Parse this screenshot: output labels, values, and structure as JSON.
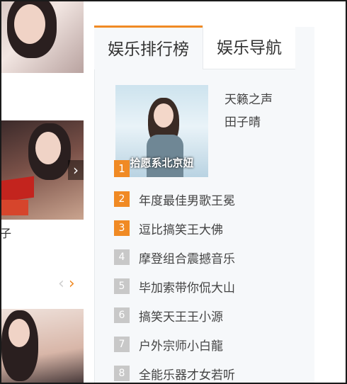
{
  "left_column": {
    "caption": "子",
    "carousel": {
      "prev_icon": "‹",
      "next_icon": "›"
    },
    "thumb_arrow": "›"
  },
  "tabs": [
    {
      "label": "娱乐排行榜",
      "active": true
    },
    {
      "label": "娱乐导航",
      "active": false
    }
  ],
  "featured": {
    "rank": "1",
    "cover_text": "拾愿系北京妞",
    "song": "天籁之声",
    "artist": "田子晴"
  },
  "ranking": [
    {
      "rank": "2",
      "title": "年度最佳男歌王冕",
      "hot": true
    },
    {
      "rank": "3",
      "title": "逗比搞笑王大佛",
      "hot": true
    },
    {
      "rank": "4",
      "title": "摩登组合震撼音乐",
      "hot": false
    },
    {
      "rank": "5",
      "title": "毕加索带你侃大山",
      "hot": false
    },
    {
      "rank": "6",
      "title": "搞笑天王王小源",
      "hot": false
    },
    {
      "rank": "7",
      "title": "户外宗师小白龍",
      "hot": false
    },
    {
      "rank": "8",
      "title": "全能乐器才女若听",
      "hot": false
    }
  ],
  "colors": {
    "accent": "#f08a24",
    "rank_gray": "#c8c8c8",
    "panel_bg": "#f6f8fa"
  }
}
